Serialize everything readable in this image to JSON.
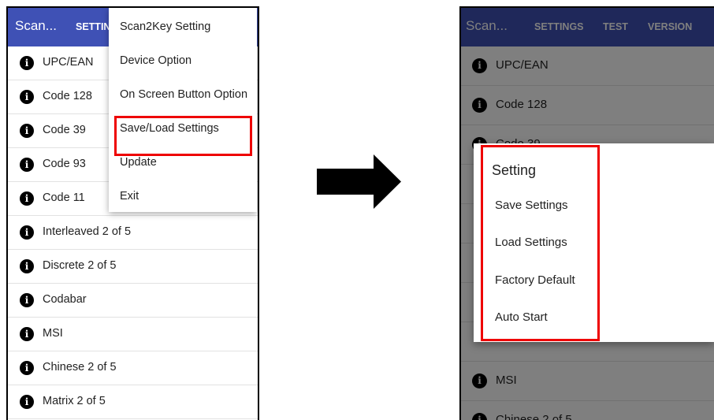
{
  "left": {
    "app_title": "Scan...",
    "settings_tab": "SETTIN",
    "list": [
      "UPC/EAN",
      "Code 128",
      "Code 39",
      "Code 93",
      "Code 11",
      "Interleaved 2 of 5",
      "Discrete 2 of 5",
      "Codabar",
      "MSI",
      "Chinese 2 of 5",
      "Matrix 2 of 5"
    ],
    "menu": [
      "Scan2Key Setting",
      "Device Option",
      "On Screen Button Option",
      "Save/Load Settings",
      "Update",
      "Exit"
    ]
  },
  "right": {
    "app_title": "Scan...",
    "tabs": [
      "SETTINGS",
      "TEST",
      "VERSION"
    ],
    "list": [
      "UPC/EAN",
      "Code 128",
      "Code 39",
      "",
      "",
      "",
      "",
      "",
      "MSI",
      "Chinese 2 of 5"
    ],
    "dialog": {
      "title": "Setting",
      "items": [
        "Save Settings",
        "Load Settings",
        "Factory Default",
        "Auto Start"
      ]
    }
  },
  "colors": {
    "appbar": "#3f51b5",
    "highlight": "#ee0000",
    "dim": "rgba(0,0,0,0.5)"
  },
  "icons": {
    "row_icon": "info-icon",
    "arrow": "right-arrow-icon"
  }
}
